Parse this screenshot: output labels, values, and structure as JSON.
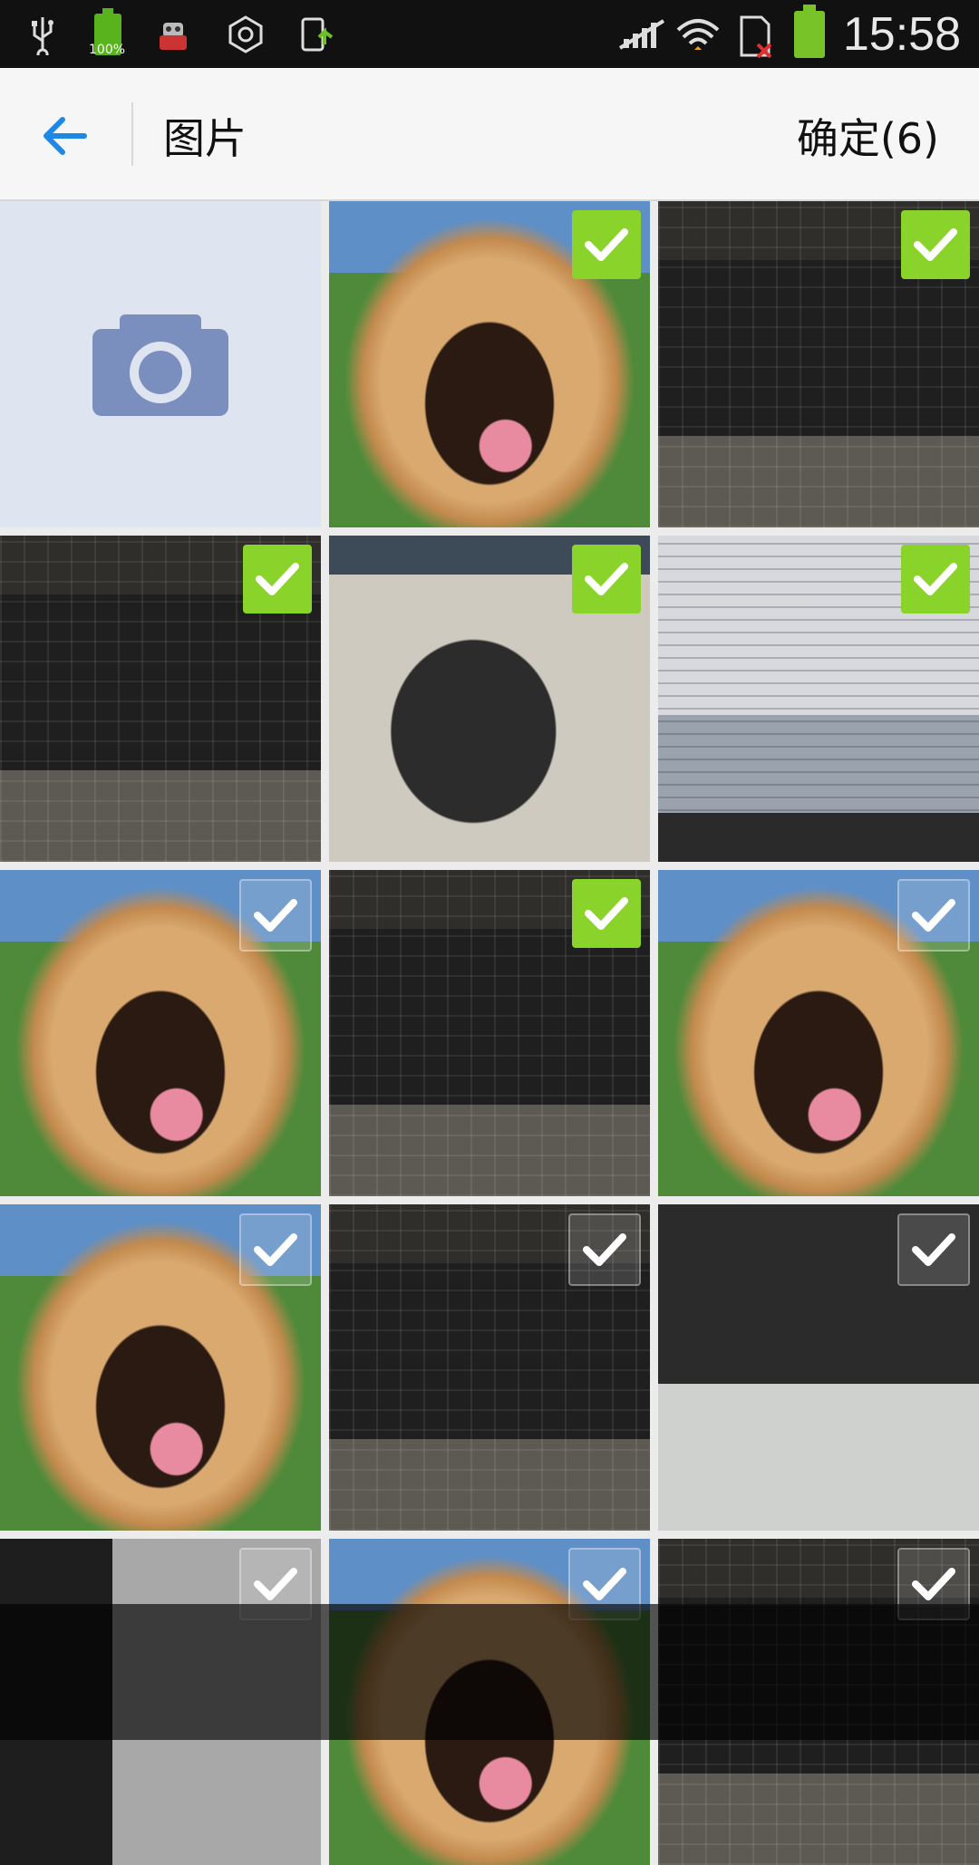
{
  "status_bar": {
    "time": "15:58",
    "battery_small_pct": "100%",
    "left_icons": [
      "usb-icon",
      "battery-charging-icon",
      "robot-app-icon",
      "hexagon-icon",
      "screen-upload-icon"
    ],
    "right_icons": [
      "no-signal-icon",
      "wifi-icon",
      "sim-error-icon",
      "battery-icon"
    ]
  },
  "action_bar": {
    "title": "图片",
    "confirm_label": "确定(6)"
  },
  "grid": {
    "camera_tile": "camera-icon",
    "items": [
      {
        "type": "dog",
        "checked": true
      },
      {
        "type": "keyboard",
        "checked": true
      },
      {
        "type": "keyboard",
        "checked": true
      },
      {
        "type": "monitor",
        "checked": true
      },
      {
        "type": "code",
        "checked": true
      },
      {
        "type": "dog",
        "checked": false
      },
      {
        "type": "keyboard",
        "checked": true
      },
      {
        "type": "dog",
        "checked": false
      },
      {
        "type": "dog",
        "checked": false
      },
      {
        "type": "keyboard",
        "checked": false
      },
      {
        "type": "dark",
        "checked": false
      },
      {
        "type": "grey",
        "checked": false
      },
      {
        "type": "dog",
        "checked": false
      },
      {
        "type": "keyboard",
        "checked": false
      }
    ]
  },
  "colors": {
    "accent": "#1e88e5",
    "check_on": "#8ad32a",
    "camera_tile_bg": "#dfe4f1"
  }
}
